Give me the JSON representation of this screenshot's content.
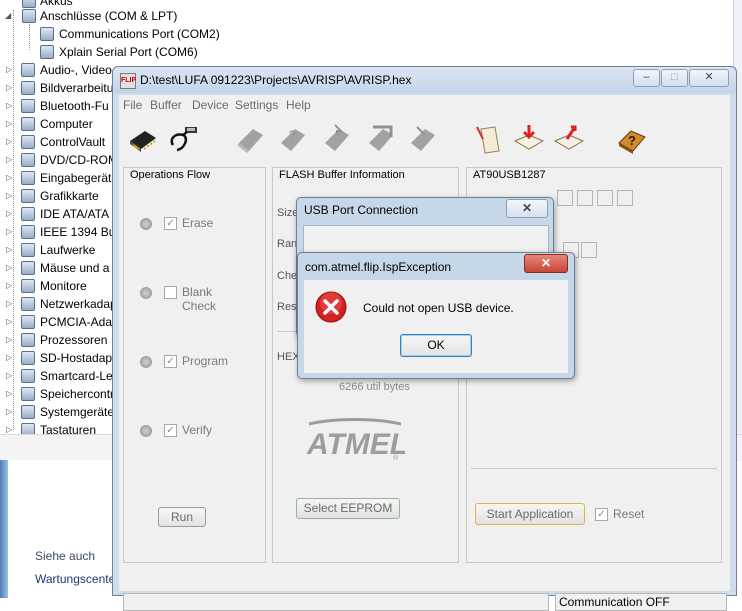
{
  "device_tree": {
    "top_partial": "Akkus",
    "group_expanded": "Anschlüsse (COM & LPT)",
    "children": [
      "Communications Port (COM2)",
      "Xplain Serial Port (COM6)"
    ],
    "categories": [
      "Audio-, Video",
      "Bildverarbeitu",
      "Bluetooth-Fu",
      "Computer",
      "ControlVault",
      "DVD/CD-ROM",
      "Eingabegeräte",
      "Grafikkarte",
      "IDE ATA/ATA",
      "IEEE 1394 Bus",
      "Laufwerke",
      "Mäuse und a",
      "Monitore",
      "Netzwerkadap",
      "PCMCIA-Ada",
      "Prozessoren",
      "SD-Hostadap",
      "Smartcard-Le",
      "Speichercontr",
      "Systemgeräte",
      "Tastaturen"
    ]
  },
  "control_panel": {
    "see_also": "Siehe auch",
    "link": "Wartungscente"
  },
  "flip_window": {
    "title": "D:\\test\\LUFA 091223\\Projects\\AVRISP\\AVRISP.hex",
    "app_icon_text": "FLIP",
    "caption_buttons": [
      "–",
      "□",
      "✕"
    ],
    "menu": [
      "File",
      "Buffer",
      "Device",
      "Settings",
      "Help"
    ],
    "toolbar_icons": [
      "chip-icon",
      "usb-cable-icon",
      "erase-icon",
      "blank-check-icon",
      "program-icon",
      "verify-icon",
      "read-icon",
      "parse-file-icon",
      "load-file-icon",
      "save-file-icon",
      "help-book-icon"
    ],
    "operations_flow": {
      "title": "Operations Flow",
      "items": [
        {
          "label": "Erase",
          "checked": true
        },
        {
          "label": "Blank Check",
          "checked": false
        },
        {
          "label": "Program",
          "checked": true
        },
        {
          "label": "Verify",
          "checked": true
        }
      ],
      "run_label": "Run"
    },
    "flash_buffer": {
      "title": "FLASH Buffer Information",
      "labels": [
        "Size",
        "Ran",
        "Che",
        "Rese",
        "HEX"
      ],
      "util_bytes": "6266 util bytes",
      "logo": "ATMEL",
      "select_eeprom": "Select EEPROM"
    },
    "device_panel": {
      "title": "AT90USB1287",
      "start_application": "Start Application",
      "reset_label": "Reset",
      "reset_checked": true
    },
    "status_right": "Communication OFF",
    "status_left": ""
  },
  "usb_dialog": {
    "title": "USB Port Connection",
    "close": "✕"
  },
  "error_dialog": {
    "title": "com.atmel.flip.IspException",
    "close": "✕",
    "message": "Could not open USB device.",
    "ok_label": "OK",
    "colors": {
      "close_bg": "#c7463a",
      "error_icon": "#cc2020"
    }
  }
}
